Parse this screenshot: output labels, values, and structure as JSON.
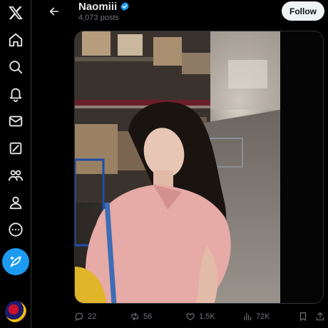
{
  "header": {
    "display_name": "Naomiii",
    "post_count": "4,073 posts",
    "follow_label": "Follow"
  },
  "nav": {
    "icons": [
      "x-logo-icon",
      "home-icon",
      "search-icon",
      "notifications-icon",
      "messages-icon",
      "grok-icon",
      "communities-icon",
      "profile-icon",
      "more-icon",
      "post-compose-icon"
    ]
  },
  "actions": {
    "replies": "22",
    "reposts": "56",
    "likes": "1.5K",
    "views": "72K"
  },
  "colors": {
    "accent": "#1d9bf0",
    "background": "#000000",
    "muted_text": "#71767b",
    "follow_bg": "#eff3f4"
  }
}
